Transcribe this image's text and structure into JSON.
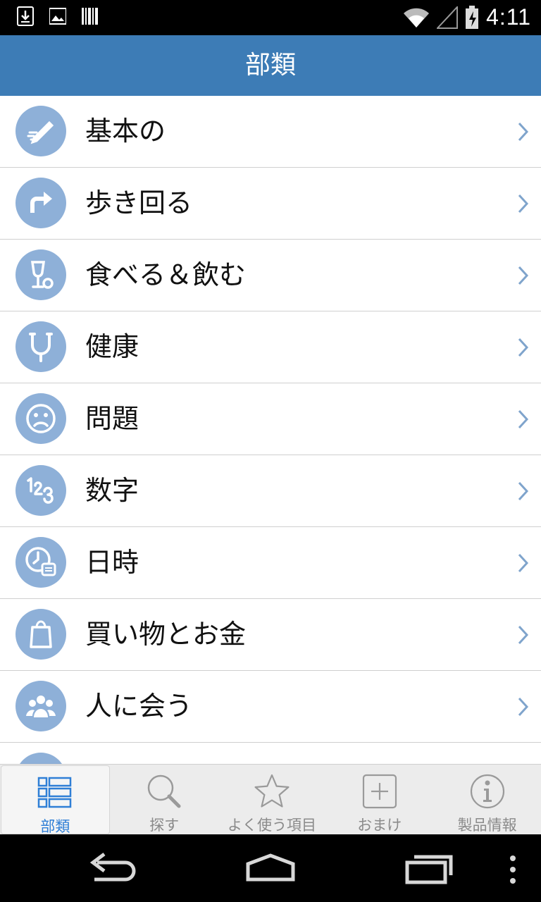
{
  "status_bar": {
    "time": "4:11"
  },
  "header": {
    "title": "部類"
  },
  "categories": [
    {
      "label": "基本の",
      "icon": "pencil-icon"
    },
    {
      "label": "歩き回る",
      "icon": "turn-arrow-icon"
    },
    {
      "label": "食べる＆飲む",
      "icon": "wine-glass-icon"
    },
    {
      "label": "健康",
      "icon": "stethoscope-icon"
    },
    {
      "label": "問題",
      "icon": "sad-face-icon"
    },
    {
      "label": "数字",
      "icon": "numbers-icon"
    },
    {
      "label": "日時",
      "icon": "clock-calendar-icon"
    },
    {
      "label": "買い物とお金",
      "icon": "shopping-bag-icon"
    },
    {
      "label": "人に会う",
      "icon": "people-icon"
    }
  ],
  "tabs": [
    {
      "label": "部類",
      "icon": "list-icon",
      "active": true
    },
    {
      "label": "探す",
      "icon": "search-icon"
    },
    {
      "label": "よく使う項目",
      "icon": "star-icon"
    },
    {
      "label": "おまけ",
      "icon": "plus-box-icon"
    },
    {
      "label": "製品情報",
      "icon": "info-icon"
    }
  ],
  "colors": {
    "header": "#3d7cb6",
    "icon_badge": "#8eb0d8",
    "active_tab": "#2f7fd6"
  }
}
